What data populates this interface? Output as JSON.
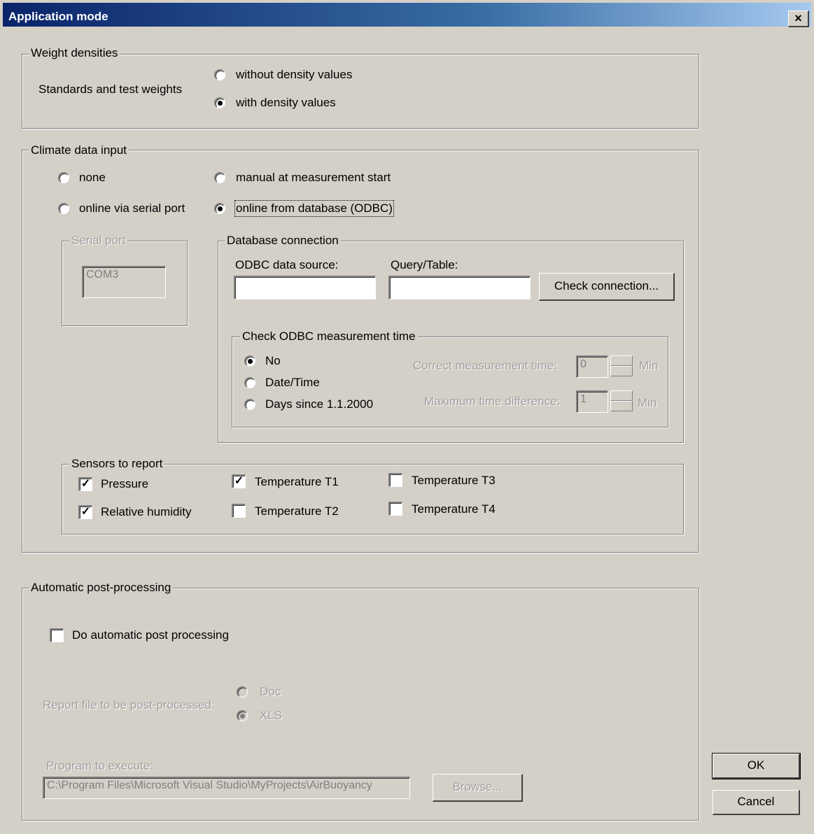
{
  "window": {
    "title": "Application mode",
    "close_glyph": "×"
  },
  "weight_densities": {
    "label": "Weight densities",
    "standards_label": "Standards and test weights",
    "options": [
      {
        "label": "without density values",
        "checked": false
      },
      {
        "label": "with density values",
        "checked": true
      }
    ]
  },
  "climate": {
    "label": "Climate data input",
    "options": {
      "none": {
        "label": "none",
        "checked": false
      },
      "manual": {
        "label": "manual at measurement start",
        "checked": false
      },
      "serial": {
        "label": "online via serial port",
        "checked": false
      },
      "odbc": {
        "label": "online from database (ODBC)",
        "checked": true
      }
    },
    "serial_port": {
      "label": "Serial port",
      "value": "COM3"
    },
    "database": {
      "label": "Database connection",
      "odbc_source_label": "ODBC data source:",
      "odbc_source_value": "",
      "query_label": "Query/Table:",
      "query_value": "",
      "check_button": "Check connection...",
      "time_check": {
        "label": "Check ODBC measurement time",
        "options": [
          {
            "label": "No",
            "checked": true
          },
          {
            "label": "Date/Time",
            "checked": false
          },
          {
            "label": "Days since 1.1.2000",
            "checked": false
          }
        ],
        "correct_label": "Correct measurement time:",
        "correct_value": "0",
        "correct_unit": "Min",
        "maxdiff_label": "Maximum time difference:",
        "maxdiff_value": "1",
        "maxdiff_unit": "Min"
      }
    },
    "sensors": {
      "label": "Sensors to report",
      "items": [
        {
          "label": "Pressure",
          "checked": true
        },
        {
          "label": "Relative humidity",
          "checked": true
        },
        {
          "label": "Temperature T1",
          "checked": true
        },
        {
          "label": "Temperature T2",
          "checked": false
        },
        {
          "label": "Temperature T3",
          "checked": false
        },
        {
          "label": "Temperature T4",
          "checked": false
        }
      ]
    }
  },
  "post": {
    "label": "Automatic post-processing",
    "do_label": "Do automatic post processing",
    "do_checked": false,
    "report_label": "Report file to be post-processed:",
    "report_options": [
      {
        "label": "Doc",
        "checked": false
      },
      {
        "label": "XLS",
        "checked": true
      }
    ],
    "program_label": "Program to execute:",
    "program_value": "C:\\Program Files\\Microsoft Visual Studio\\MyProjects\\AirBuoyancy",
    "browse_button": "Browse..."
  },
  "buttons": {
    "ok": "OK",
    "cancel": "Cancel"
  }
}
